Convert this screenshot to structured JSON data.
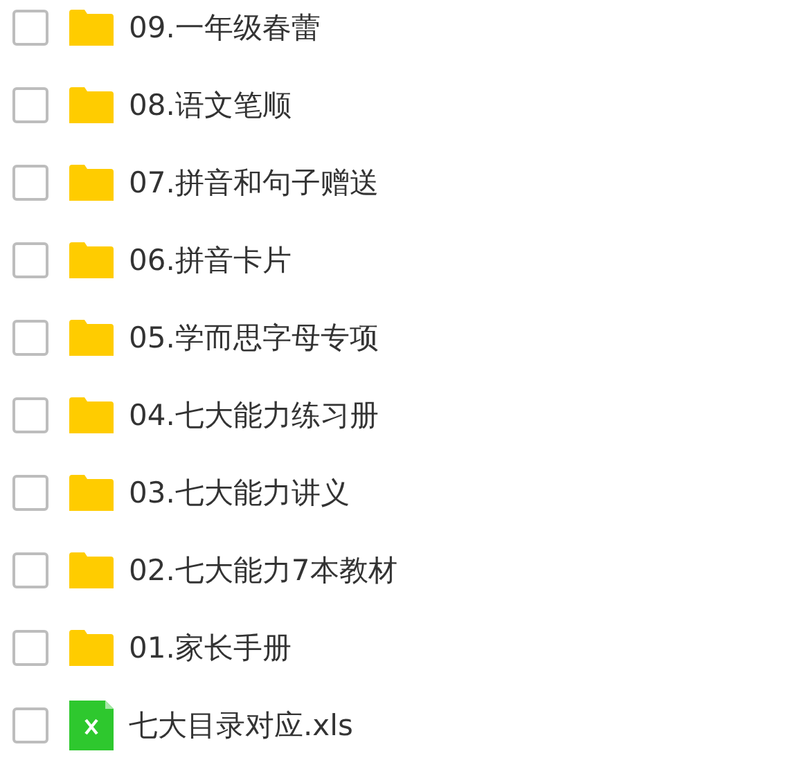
{
  "files": [
    {
      "kind": "folder",
      "name": "09.一年级春蕾",
      "checked": false
    },
    {
      "kind": "folder",
      "name": "08.语文笔顺",
      "checked": false
    },
    {
      "kind": "folder",
      "name": "07.拼音和句子赠送",
      "checked": false
    },
    {
      "kind": "folder",
      "name": "06.拼音卡片",
      "checked": false
    },
    {
      "kind": "folder",
      "name": "05.学而思字母专项",
      "checked": false
    },
    {
      "kind": "folder",
      "name": "04.七大能力练习册",
      "checked": false
    },
    {
      "kind": "folder",
      "name": "03.七大能力讲义",
      "checked": false
    },
    {
      "kind": "folder",
      "name": "02.七大能力7本教材",
      "checked": false
    },
    {
      "kind": "folder",
      "name": "01.家长手册",
      "checked": false
    },
    {
      "kind": "spreadsheet",
      "name": "七大目录对应.xls",
      "checked": false
    }
  ]
}
